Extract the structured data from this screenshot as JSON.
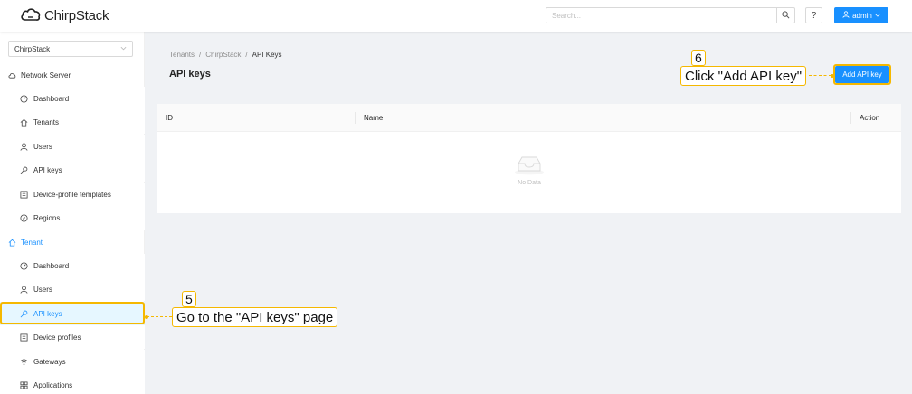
{
  "header": {
    "logo_text": "ChirpStack",
    "search_placeholder": "Search...",
    "help_label": "?",
    "user_label": "admin"
  },
  "sidebar": {
    "tenant_selected": "ChirpStack",
    "network_server_label": "Network Server",
    "network_server_items": [
      {
        "label": "Dashboard",
        "icon": "dashboard-icon"
      },
      {
        "label": "Tenants",
        "icon": "home-icon"
      },
      {
        "label": "Users",
        "icon": "user-icon"
      },
      {
        "label": "API keys",
        "icon": "key-icon"
      },
      {
        "label": "Device-profile templates",
        "icon": "template-icon"
      },
      {
        "label": "Regions",
        "icon": "compass-icon"
      }
    ],
    "tenant_label": "Tenant",
    "tenant_items": [
      {
        "label": "Dashboard",
        "icon": "dashboard-icon"
      },
      {
        "label": "Users",
        "icon": "user-icon"
      },
      {
        "label": "API keys",
        "icon": "key-icon"
      },
      {
        "label": "Device profiles",
        "icon": "profile-icon"
      },
      {
        "label": "Gateways",
        "icon": "wifi-icon"
      },
      {
        "label": "Applications",
        "icon": "apps-icon"
      }
    ]
  },
  "content": {
    "breadcrumb": [
      "Tenants",
      "ChirpStack",
      "API Keys"
    ],
    "title": "API keys",
    "add_button": "Add API key",
    "table": {
      "columns": [
        "ID",
        "Name",
        "Action"
      ],
      "empty_text": "No Data"
    }
  },
  "annotations": {
    "step5_number": "5",
    "step5_text": "Go to the \"API keys\" page",
    "step6_number": "6",
    "step6_text": "Click \"Add API key\""
  },
  "colors": {
    "primary": "#1890ff",
    "annotation": "#f5b800",
    "selected_bg": "#e6f7ff"
  }
}
